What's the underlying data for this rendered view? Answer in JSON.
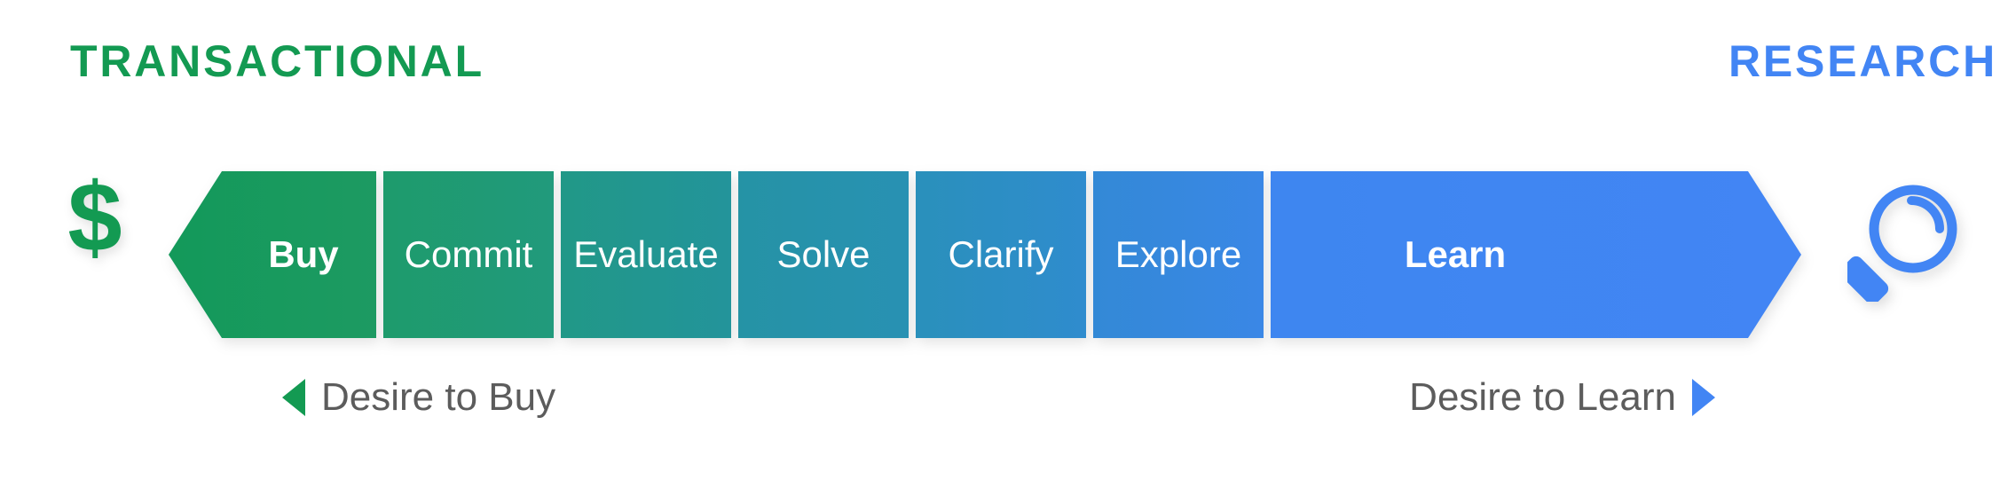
{
  "header": {
    "left_label": "TRANSACTIONAL",
    "right_label": "RESEARCH",
    "left_color": "#139a52",
    "right_color": "#4285f4"
  },
  "icons": {
    "left": {
      "name": "dollar-sign-icon",
      "glyph": "$",
      "color": "#139a52"
    },
    "right": {
      "name": "magnifying-glass-icon",
      "color": "#4285f4"
    }
  },
  "spectrum": {
    "segments": [
      {
        "label": "Buy",
        "color": "#169a56",
        "bold": true,
        "shape": "left-point"
      },
      {
        "label": "Commit",
        "color": "#1f9b70",
        "bold": false,
        "shape": "rect"
      },
      {
        "label": "Evaluate",
        "color": "#219690",
        "bold": false,
        "shape": "rect"
      },
      {
        "label": "Solve",
        "color": "#2693a8",
        "bold": false,
        "shape": "rect"
      },
      {
        "label": "Clarify",
        "color": "#2b90bd",
        "bold": false,
        "shape": "rect"
      },
      {
        "label": "Explore",
        "color": "#3589d8",
        "bold": false,
        "shape": "rect"
      },
      {
        "label": "Learn",
        "color": "#4285f4",
        "bold": true,
        "shape": "right-point"
      }
    ]
  },
  "directions": {
    "left": {
      "text": "Desire to Buy",
      "arrow": "left-triangle-icon",
      "arrow_color": "#139a52"
    },
    "right": {
      "text": "Desire to Learn",
      "arrow": "right-triangle-icon",
      "arrow_color": "#4285f4"
    }
  }
}
